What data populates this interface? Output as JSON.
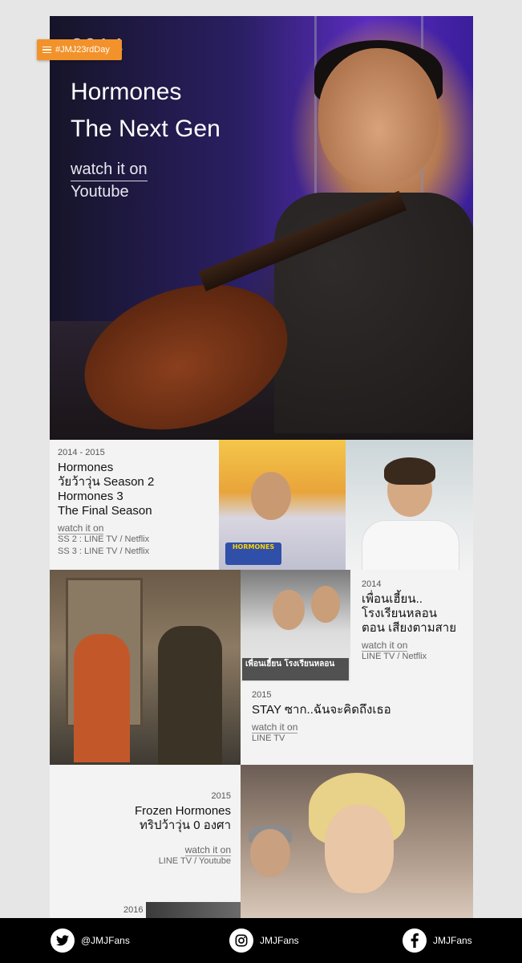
{
  "hashtag": "#JMJ23rdDay",
  "hero": {
    "year": "2014",
    "title_line1": "Hormones",
    "title_line2": "The Next Gen",
    "watch_label": "watch it on",
    "watch_platform": "Youtube"
  },
  "entries": [
    {
      "year": "2014 - 2015",
      "title_lines": [
        "Hormones",
        "วัยว้าวุ่น Season 2",
        "Hormones 3",
        "The Final Season"
      ],
      "watch_label": "watch it on",
      "platforms": [
        "SS 2 : LINE TV / Netflix",
        "SS 3 : LINE TV / Netflix"
      ]
    },
    {
      "year": "2014",
      "title_lines": [
        "เพื่อนเฮี้ยน..",
        "โรงเรียนหลอน",
        "ตอน เสียงตามสาย"
      ],
      "watch_label": "watch it on",
      "platforms": [
        "LINE TV / Netflix"
      ]
    },
    {
      "year": "2015",
      "title_lines": [
        "STAY ซาก..ฉันจะคิดถึงเธอ"
      ],
      "watch_label": "watch it on",
      "platforms": [
        "LINE TV"
      ]
    },
    {
      "year": "2015",
      "title_lines": [
        "Frozen Hormones",
        "ทริปว้าวุ่น 0 องศา"
      ],
      "watch_label": "watch it on",
      "platforms": [
        "LINE TV / Youtube"
      ]
    },
    {
      "year": "2016"
    }
  ],
  "photo_captions": {
    "hormones_logo": "HORMONES",
    "ghost_school": "เพื่อนเฮี้ยน โรงเรียนหลอน"
  },
  "footer": {
    "twitter": "@JMJFans",
    "instagram": "JMJFans",
    "facebook": "JMJFans"
  },
  "icons": {
    "menu": "menu-icon",
    "twitter": "twitter-icon",
    "instagram": "instagram-icon",
    "facebook": "facebook-icon"
  },
  "colors": {
    "hashtag_bg": "#f2922a",
    "footer_bg": "#000000",
    "panel_bg": "#f3f3f3"
  }
}
